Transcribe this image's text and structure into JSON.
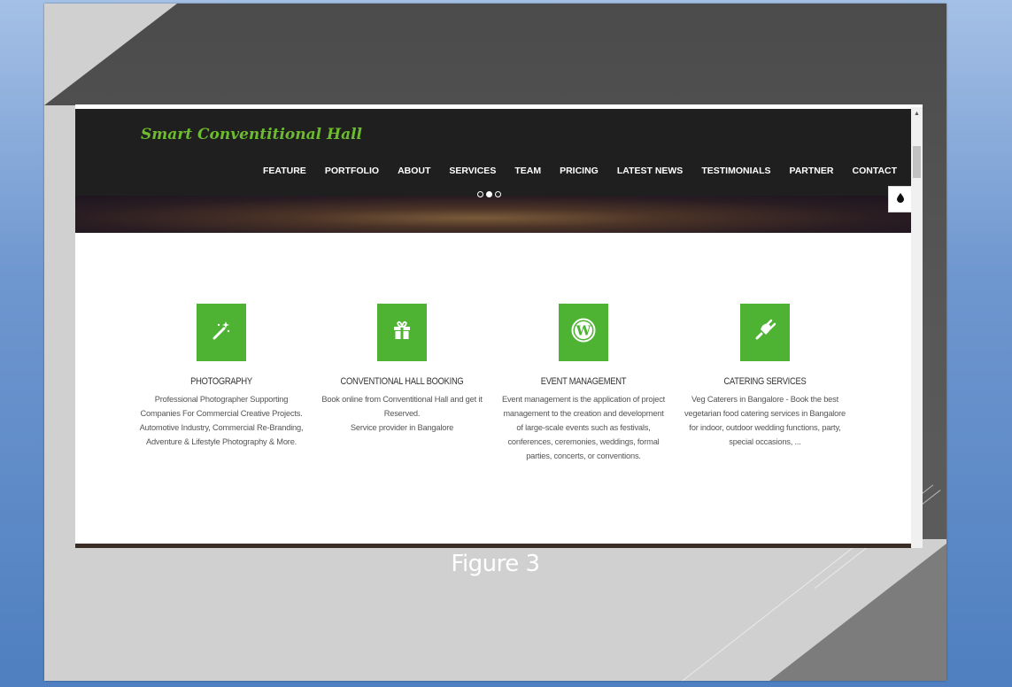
{
  "caption": "Figure 3",
  "site": {
    "logo": "Smart Conventitional Hall",
    "nav": [
      "FEATURE",
      "PORTFOLIO",
      "ABOUT",
      "SERVICES",
      "TEAM",
      "PRICING",
      "LATEST NEWS",
      "TESTIMONIALS",
      "PARTNER",
      "CONTACT"
    ],
    "slider_dots": 3,
    "slider_active": 1,
    "accent_color": "#4eb232",
    "features": [
      {
        "icon": "magic-wand-icon",
        "title": "PHOTOGRAPHY",
        "text": "Professional Photographer Supporting Companies For Commercial Creative Projects. Automotive Industry, Commercial Re-Branding, Adventure & Lifestyle Photography & More."
      },
      {
        "icon": "gift-icon",
        "title": "CONVENTIONAL HALL BOOKING",
        "text": "Book online from Conventitional Hall and get it Reserved.\nService provider in Bangalore"
      },
      {
        "icon": "wordpress-icon",
        "title": "EVENT MANAGEMENT",
        "text": "Event management is the application of project management to the creation and development of large-scale events such as festivals, conferences, ceremonies, weddings, formal parties, concerts, or conventions."
      },
      {
        "icon": "plug-icon",
        "title": "CATERING SERVICES",
        "text": "Veg Caterers in Bangalore - Book the best vegetarian food catering services in Bangalore for indoor, outdoor wedding functions, party, special occasions, ..."
      }
    ]
  }
}
